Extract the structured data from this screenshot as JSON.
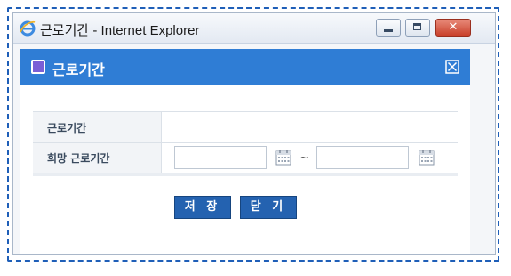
{
  "window": {
    "title": "근로기간 - Internet Explorer",
    "icon": "internet-explorer-icon"
  },
  "popup": {
    "title": "근로기간",
    "header_color": "#2f7dd5"
  },
  "form": {
    "rows": [
      {
        "label": "근로기간",
        "value": ""
      },
      {
        "label": "희망 근로기간",
        "start_value": "",
        "separator": "~",
        "end_value": ""
      }
    ]
  },
  "buttons": {
    "save": "저 장",
    "close": "닫 기"
  },
  "icons": {
    "calendar": "calendar-icon",
    "popup_close": "close-box-icon"
  }
}
